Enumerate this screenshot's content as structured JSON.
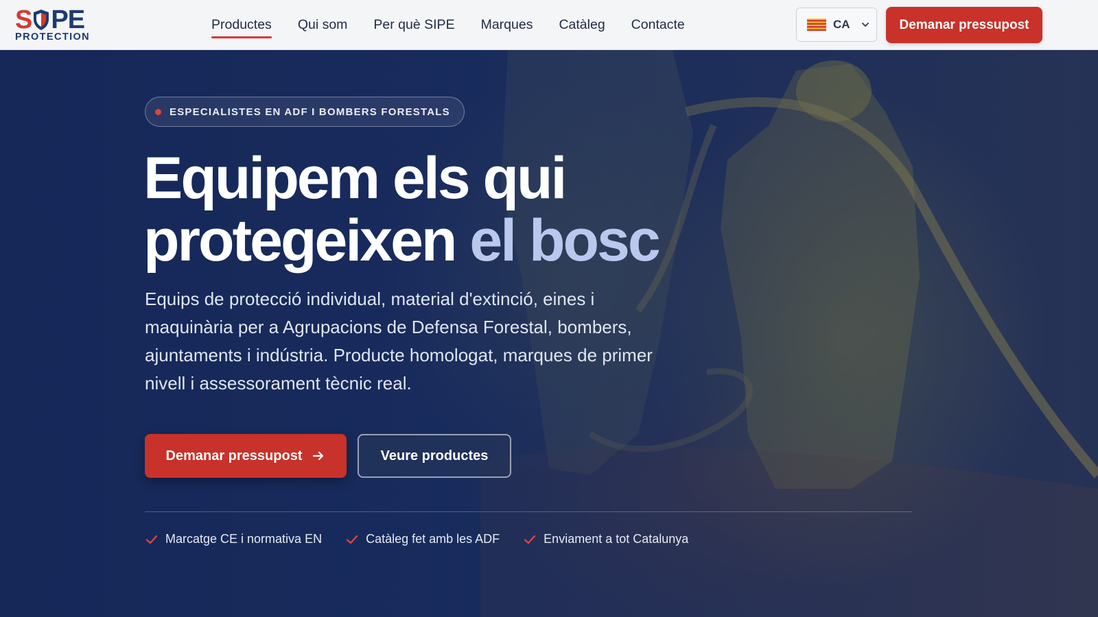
{
  "header": {
    "logo": {
      "top": "SIPE",
      "sub": "PROTECTION"
    },
    "nav": [
      {
        "label": "Productes",
        "active": true
      },
      {
        "label": "Qui som",
        "active": false
      },
      {
        "label": "Per què SIPE",
        "active": false
      },
      {
        "label": "Marques",
        "active": false
      },
      {
        "label": "Catàleg",
        "active": false
      },
      {
        "label": "Contacte",
        "active": false
      }
    ],
    "language": {
      "code": "CA",
      "flag_icon": "catalonia-flag-icon"
    },
    "cta_label": "Demanar pressupost"
  },
  "hero": {
    "badge": "ESPECIALISTES EN ADF I BOMBERS FORESTALS",
    "headline_line1": "Equipem els qui",
    "headline_line2_main": "protegeixen",
    "headline_line2_accent": "el bosc",
    "lead": "Equips de protecció individual, material d'extinció, eines i maquinària per a Agrupacions de Defensa Forestal, bombers, ajuntaments i indústria. Producte homologat, marques de primer nivell i assessorament tècnic real.",
    "primary_button": "Demanar pressupost",
    "secondary_button": "Veure productes",
    "features": [
      "Marcatge CE i normativa EN",
      "Catàleg fet amb les ADF",
      "Enviament a tot Catalunya"
    ]
  },
  "colors": {
    "brand_red": "#c8322a",
    "brand_blue": "#1e3a72",
    "hero_bg": "#1b2d55",
    "accent_text": "#b9c8ec"
  }
}
